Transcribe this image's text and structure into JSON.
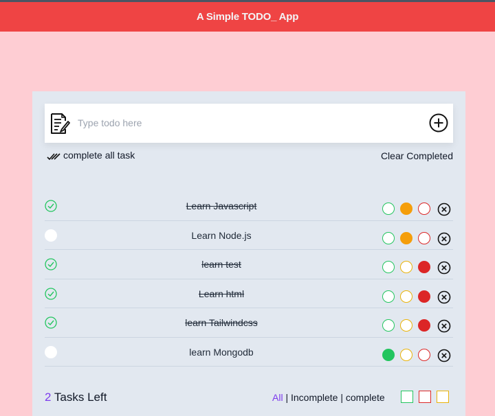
{
  "app": {
    "title": "A Simple TODO_ App"
  },
  "input": {
    "placeholder": "Type todo here",
    "value": ""
  },
  "actions": {
    "complete_all_label": "complete all task",
    "clear_completed_label": "Clear Completed"
  },
  "todos": [
    {
      "text": "Learn Javascript",
      "completed": true,
      "priority": "medium"
    },
    {
      "text": "Learn Node.js",
      "completed": false,
      "priority": "medium"
    },
    {
      "text": "learn test",
      "completed": true,
      "priority": "high"
    },
    {
      "text": "Learn html",
      "completed": true,
      "priority": "high"
    },
    {
      "text": "learn Tailwindcss",
      "completed": true,
      "priority": "high"
    },
    {
      "text": "learn Mongodb",
      "completed": false,
      "priority": "low"
    }
  ],
  "footer": {
    "tasks_left_count": "2",
    "tasks_left_label": "Tasks Left",
    "filter_all": "All",
    "filter_incomplete": "Incomplete",
    "filter_complete": "complete",
    "separator": "|"
  },
  "colors": {
    "header": "#ef4444",
    "background": "#fecdd3",
    "card": "#e2e8f0",
    "accent": "#7c3aed",
    "low": "#22c55e",
    "medium": "#f59e0b",
    "high": "#dc2626"
  }
}
